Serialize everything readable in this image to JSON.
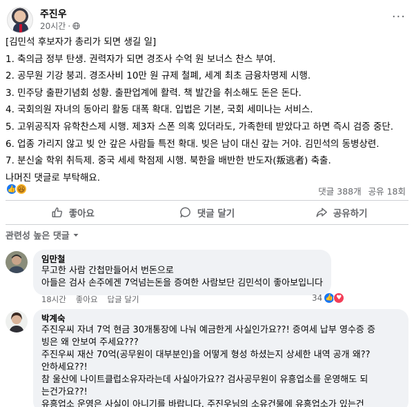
{
  "post": {
    "author": "주진우",
    "time": "20시간",
    "lines": [
      "[김민석 후보자가 총리가 되면 생길 일]",
      "1. 축의금 정부 탄생. 권력자가 되면 경조사 수억 원 보너스 찬스 부여.",
      "2. 공무원 기강 붕괴. 경조사비 10만 원 규제 철폐, 세계 최초 금융차명제 시행.",
      "3. 민주당 출판기념회 성황. 출판업계에 활력. 책 발간을 취소해도 돈은 돈다.",
      "4. 국회의원 자녀의 동아리 활동 대폭 확대. 입법은 기본, 국회 세미나는 서비스.",
      "5. 고위공직자 유학찬스제 시행. 제3자 스폰 의혹 있더라도, 가족한테 받았다고 하면 즉시 검증 중단.",
      "6. 업종 가리지 않고 빚 안 갚은 사람들 특전 확대. 빚은 남이 대신 갚는 거야. 김민석의 동병상련.",
      "7. 분신술 학위 취득제. 중국 세세 학점제 시행. 북한을 배반한 반도자(叛逃者) 축출.",
      "나머진 댓글로 부탁해요."
    ],
    "comments_count": "댓글 388개",
    "shares_count": "공유 18회"
  },
  "actions": {
    "like": "좋아요",
    "comment": "댓글 달기",
    "share": "공유하기"
  },
  "sort_label": "관련성 높은 댓글",
  "comments": [
    {
      "name": "임만철",
      "lines": [
        "무고한 사람 간첩만들어서 번돈으로",
        "아들은 검사 손주에겐 7억넘는돈을 증여한 사람보단 김민석이 좋아보입니다"
      ],
      "time": "18시간",
      "like_label": "좋아요",
      "reply_label": "답글 달기",
      "reactions": "34"
    },
    {
      "name": "박계숙",
      "lines": [
        "주진우씨 자녀 7억 현금 30개통장에 나눠 예금한게 사실인가요??! 증여세 납부 영수증 증",
        "빙은 왜 안보여 주세요???",
        "주진우씨 재산 70억(공무원이 대부분인)을 어떻게 형성 하셨는지 상세한 내역 공개 왜??",
        "안하세요??!",
        "참 울산에 나이트클럽소유자라는데 사실아가요?? 검사공무원이 유흥업소를 운영해도 되",
        "는건가요??!",
        "유흥업소 운영은 사실이 아니기를 바랍니다. 주진우님의 소유건물에 유흥업소가 있는건"
      ]
    }
  ],
  "colors": {
    "like_blue": "#1877f2",
    "secondary_text": "#65676b",
    "bubble": "#f0f2f5"
  }
}
